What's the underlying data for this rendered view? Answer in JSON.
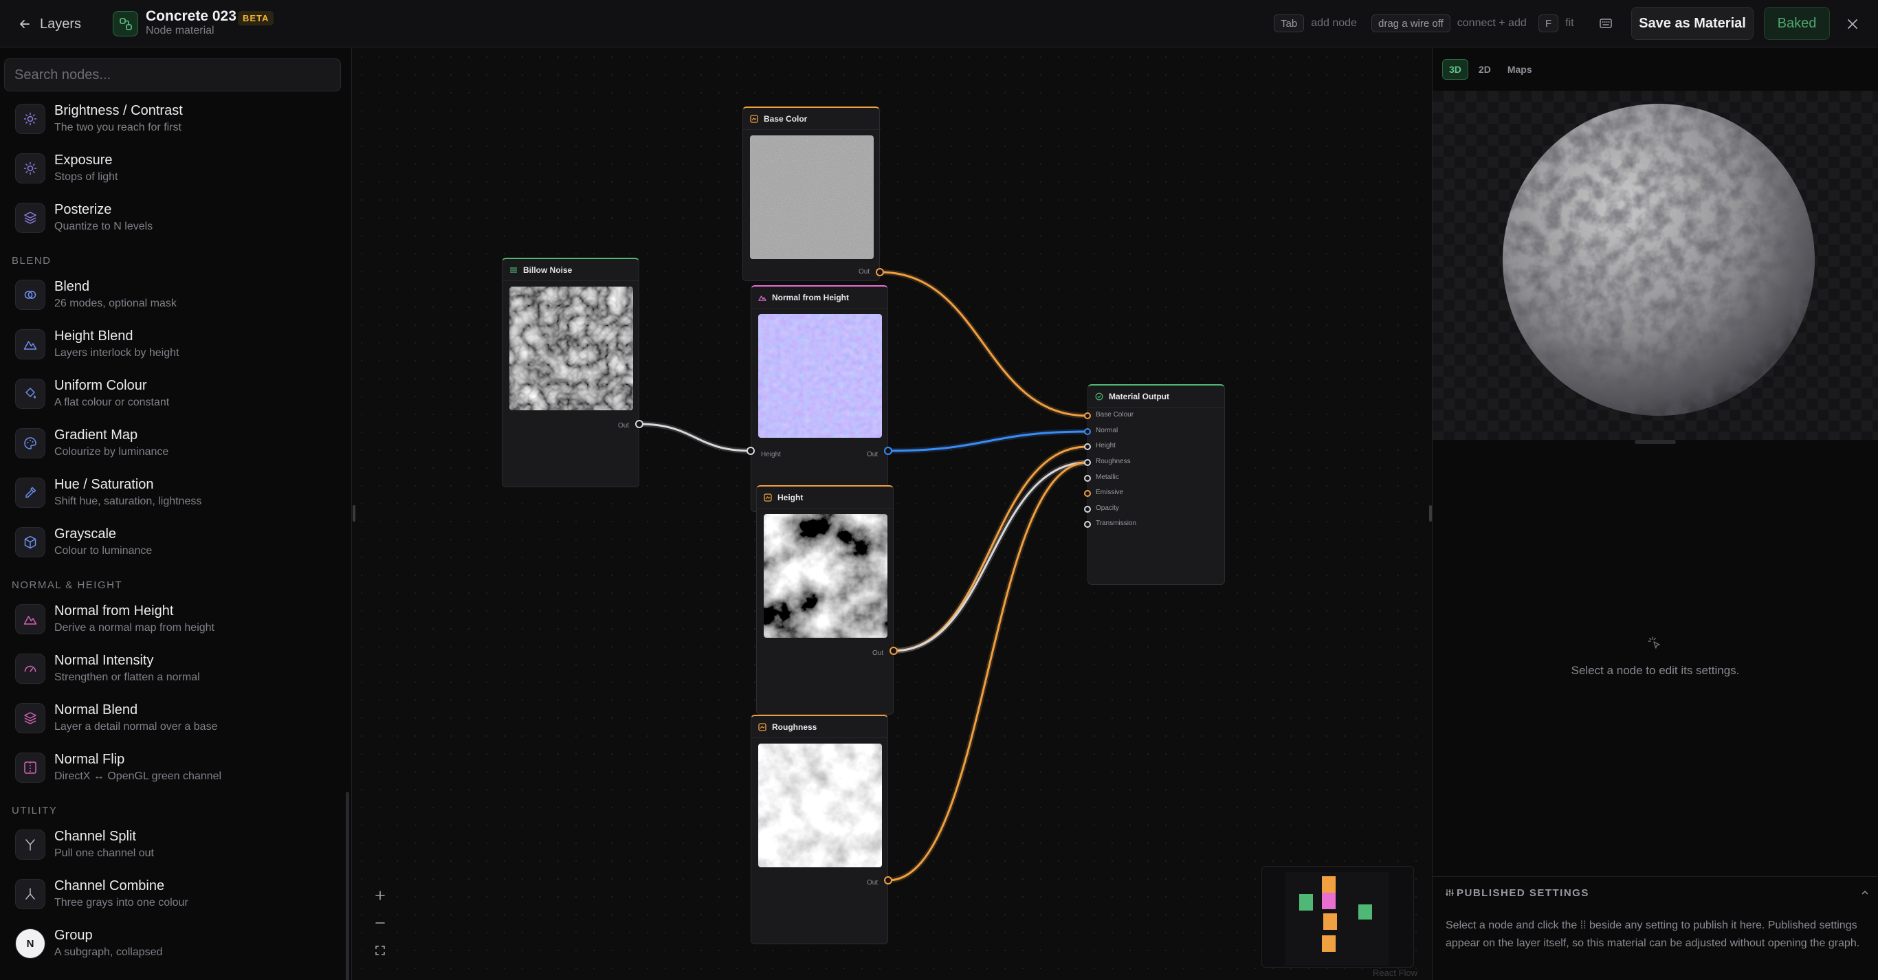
{
  "topbar": {
    "back_label": "Layers",
    "title": "Concrete 023",
    "badge": "BETA",
    "subtitle": "Node material",
    "hints": [
      {
        "key": "Tab",
        "text": "add node"
      },
      {
        "key": "drag a wire off",
        "text": "connect + add"
      },
      {
        "key": "F",
        "text": "fit"
      }
    ],
    "save_label": "Save as Material",
    "baked_label": "Baked"
  },
  "sidebar": {
    "search_placeholder": "Search nodes...",
    "top_items": [
      {
        "name": "Brightness / Contrast",
        "desc": "The two you reach for first",
        "icon": "sun-icon",
        "color": "#8f7de0"
      },
      {
        "name": "Exposure",
        "desc": "Stops of light",
        "icon": "sun-icon",
        "color": "#8f7de0"
      },
      {
        "name": "Posterize",
        "desc": "Quantize to N levels",
        "icon": "layers-icon",
        "color": "#8f7de0"
      }
    ],
    "sections": [
      {
        "title": "BLEND",
        "items": [
          {
            "name": "Blend",
            "desc": "26 modes, optional mask",
            "icon": "blend-icon",
            "color": "#6e8ff0"
          },
          {
            "name": "Height Blend",
            "desc": "Layers interlock by height",
            "icon": "mountain-icon",
            "color": "#6e8ff0"
          },
          {
            "name": "Uniform Colour",
            "desc": "A flat colour or constant",
            "icon": "bucket-icon",
            "color": "#6e8ff0"
          },
          {
            "name": "Gradient Map",
            "desc": "Colourize by luminance",
            "icon": "palette-icon",
            "color": "#6e8ff0"
          },
          {
            "name": "Hue / Saturation",
            "desc": "Shift hue, saturation, lightness",
            "icon": "pipette-icon",
            "color": "#6e8ff0"
          },
          {
            "name": "Grayscale",
            "desc": "Colour to luminance",
            "icon": "cube-icon",
            "color": "#6e8ff0"
          }
        ]
      },
      {
        "title": "NORMAL & HEIGHT",
        "items": [
          {
            "name": "Normal from Height",
            "desc": "Derive a normal map from height",
            "icon": "mountain-icon",
            "color": "#d460b8"
          },
          {
            "name": "Normal Intensity",
            "desc": "Strengthen or flatten a normal",
            "icon": "gauge-icon",
            "color": "#d460b8"
          },
          {
            "name": "Normal Blend",
            "desc": "Layer a detail normal over a base",
            "icon": "layers-icon",
            "color": "#d460b8"
          },
          {
            "name": "Normal Flip",
            "desc": "DirectX ↔ OpenGL green channel",
            "icon": "flip-icon",
            "color": "#d460b8"
          }
        ]
      },
      {
        "title": "UTILITY",
        "items": [
          {
            "name": "Channel Split",
            "desc": "Pull one channel out",
            "icon": "split-icon",
            "color": "#b9b9c0"
          },
          {
            "name": "Channel Combine",
            "desc": "Three grays into one colour",
            "icon": "merge-icon",
            "color": "#b9b9c0"
          },
          {
            "name": "Group",
            "desc": "A subgraph, collapsed",
            "icon": "group-icon",
            "color": "#b9b9c0"
          }
        ]
      }
    ]
  },
  "graph": {
    "nodes": {
      "base_color": {
        "title": "Base Color",
        "out": "Out"
      },
      "billow": {
        "title": "Billow Noise",
        "out": "Out"
      },
      "normal_from_height": {
        "title": "Normal from Height",
        "in": "Height",
        "out": "Out"
      },
      "height": {
        "title": "Height",
        "out": "Out"
      },
      "roughness": {
        "title": "Roughness",
        "out": "Out"
      },
      "material_output": {
        "title": "Material Output",
        "inputs": [
          "Base Colour",
          "Normal",
          "Height",
          "Roughness",
          "Metallic",
          "Emissive",
          "Opacity",
          "Transmission"
        ]
      }
    },
    "credit": "React Flow",
    "colors": {
      "orange": "#f0a040",
      "blue": "#3b8cf5",
      "white": "#d8d8dc",
      "green": "#4fb874",
      "pink": "#e66fd0"
    }
  },
  "right_panel": {
    "tabs": [
      "3D",
      "2D",
      "Maps"
    ],
    "active_tab": "3D",
    "empty_message": "Select a node to edit its settings.",
    "published_title": "PUBLISHED SETTINGS",
    "published_text": "Select a node and click the ⁞⁞ beside any setting to publish it here. Published settings appear on the layer itself, so this material can be adjusted without opening the graph."
  }
}
